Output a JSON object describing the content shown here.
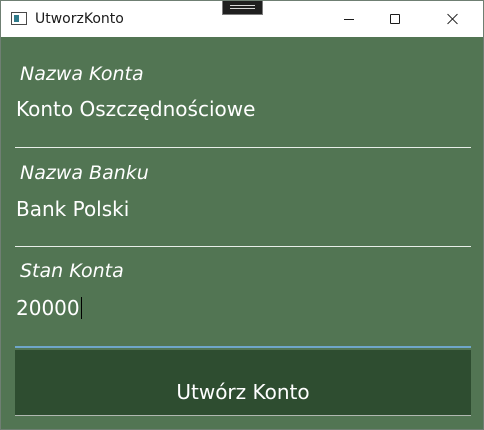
{
  "window": {
    "title": "UtworzKonto",
    "controls": [
      "minimize",
      "maximize",
      "close"
    ],
    "icon": "app-window-icon"
  },
  "form": {
    "fields": [
      {
        "label": "Nazwa Konta",
        "value": "Konto Oszczędnościowe"
      },
      {
        "label": "Nazwa Banku",
        "value": "Bank Polski"
      },
      {
        "label": "Stan Konta",
        "value": "20000",
        "focused": true
      }
    ],
    "submit_label": "Utwórz Konto"
  },
  "colors": {
    "background": "#527553",
    "button": "#2e4d30",
    "text": "#ffffff",
    "focus_underline": "#6fa6c9"
  }
}
